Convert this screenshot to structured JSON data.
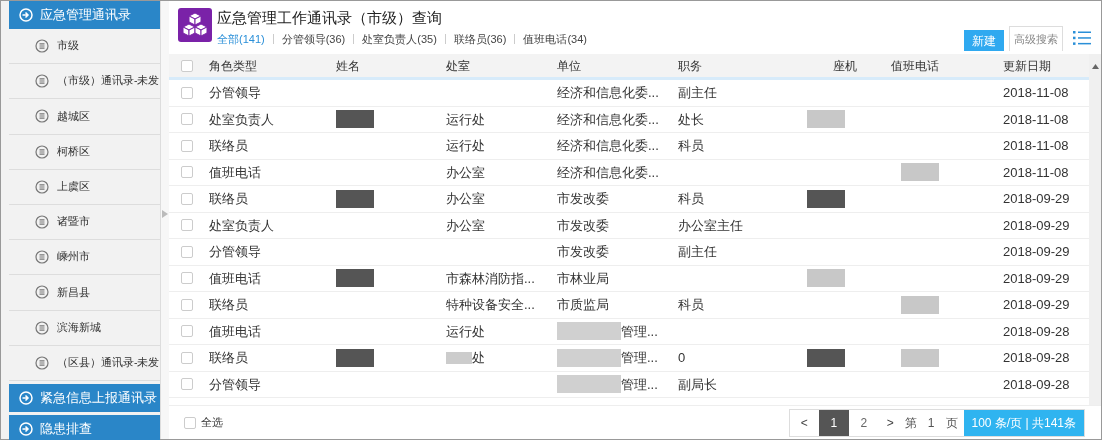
{
  "sidebar": {
    "groups": [
      {
        "label": "应急管理通讯录",
        "items": [
          {
            "label": "市级"
          },
          {
            "label": "（市级）通讯录-未发"
          },
          {
            "label": "越城区"
          },
          {
            "label": "柯桥区"
          },
          {
            "label": "上虞区"
          },
          {
            "label": "诸暨市"
          },
          {
            "label": "嵊州市"
          },
          {
            "label": "新昌县"
          },
          {
            "label": "滨海新城"
          },
          {
            "label": "（区县）通讯录-未发"
          }
        ]
      },
      {
        "label": "紧急信息上报通讯录"
      },
      {
        "label": "隐患排查"
      }
    ]
  },
  "title": "应急管理工作通讯录（市级）查询",
  "tabs": [
    {
      "label": "全部(141)",
      "selected": true
    },
    {
      "label": "分管领导(36)",
      "selected": false
    },
    {
      "label": "处室负责人(35)",
      "selected": false
    },
    {
      "label": "联络员(36)",
      "selected": false
    },
    {
      "label": "值班电话(34)",
      "selected": false
    }
  ],
  "buttons": {
    "new": "新建",
    "advanced_search": "高级搜索"
  },
  "table": {
    "header_checkbox": {
      "checked": false
    },
    "columns": [
      "角色类型",
      "姓名",
      "处室",
      "单位",
      "职务",
      "座机",
      "值班电话",
      "更新日期"
    ],
    "rows": [
      {
        "checked": false,
        "role": "分管领导",
        "name_blurred": false,
        "dept": "",
        "dept_blurred": false,
        "unit": "经济和信息化委...",
        "unit_blurred": false,
        "job": "副主任",
        "phone_blurred": false,
        "duty_blurred": false,
        "date": "2018-11-08"
      },
      {
        "checked": false,
        "role": "处室负责人",
        "name_blurred": true,
        "dept": "运行处",
        "dept_blurred": false,
        "unit": "经济和信息化委...",
        "unit_blurred": false,
        "job": "处长",
        "phone_blurred": true,
        "duty_blurred": false,
        "date": "2018-11-08"
      },
      {
        "checked": false,
        "role": "联络员",
        "name_blurred": false,
        "dept": "运行处",
        "dept_blurred": false,
        "unit": "经济和信息化委...",
        "unit_blurred": false,
        "job": "科员",
        "phone_blurred": false,
        "duty_blurred": false,
        "date": "2018-11-08"
      },
      {
        "checked": false,
        "role": "值班电话",
        "name_blurred": false,
        "dept": "办公室",
        "dept_blurred": false,
        "unit": "经济和信息化委...",
        "unit_blurred": false,
        "job": "",
        "phone_blurred": false,
        "duty_blurred": true,
        "date": "2018-11-08"
      },
      {
        "checked": false,
        "role": "联络员",
        "name_blurred": true,
        "dept": "办公室",
        "dept_blurred": false,
        "unit": "市发改委",
        "unit_blurred": false,
        "job": "科员",
        "phone_blurred": true,
        "duty_blurred": false,
        "date": "2018-09-29"
      },
      {
        "checked": false,
        "role": "处室负责人",
        "name_blurred": false,
        "dept": "办公室",
        "dept_blurred": false,
        "unit": "市发改委",
        "unit_blurred": false,
        "job": "办公室主任",
        "phone_blurred": false,
        "duty_blurred": false,
        "date": "2018-09-29"
      },
      {
        "checked": false,
        "role": "分管领导",
        "name_blurred": false,
        "dept": "",
        "dept_blurred": false,
        "unit": "市发改委",
        "unit_blurred": false,
        "job": "副主任",
        "phone_blurred": false,
        "duty_blurred": false,
        "date": "2018-09-29"
      },
      {
        "checked": false,
        "role": "值班电话",
        "name_blurred": true,
        "dept": "市森林消防指...",
        "dept_blurred": false,
        "unit": "市林业局",
        "unit_blurred": false,
        "job": "",
        "phone_blurred": true,
        "duty_blurred": false,
        "date": "2018-09-29"
      },
      {
        "checked": false,
        "role": "联络员",
        "name_blurred": false,
        "dept": "特种设备安全...",
        "dept_blurred": false,
        "unit": "市质监局",
        "unit_blurred": false,
        "job": "科员",
        "phone_blurred": false,
        "duty_blurred": true,
        "date": "2018-09-29"
      },
      {
        "checked": false,
        "role": "值班电话",
        "name_blurred": false,
        "dept": "运行处",
        "dept_blurred": false,
        "unit": "管理...",
        "unit_blurred": true,
        "job": "",
        "phone_blurred": false,
        "duty_blurred": false,
        "date": "2018-09-28"
      },
      {
        "checked": false,
        "role": "联络员",
        "name_blurred": true,
        "dept": "处",
        "dept_blurred": true,
        "unit": "管理...",
        "unit_blurred": true,
        "job": "0",
        "phone_blurred": true,
        "duty_blurred": true,
        "date": "2018-09-28"
      },
      {
        "checked": false,
        "role": "分管领导",
        "name_blurred": false,
        "dept": "",
        "dept_blurred": false,
        "unit": "管理...",
        "unit_blurred": true,
        "job": "副局长",
        "phone_blurred": false,
        "duty_blurred": false,
        "date": "2018-09-28"
      }
    ]
  },
  "footer": {
    "select_all": {
      "label": "全选",
      "checked": false
    }
  },
  "pagination": {
    "prev": "<",
    "pages": [
      {
        "label": "1",
        "selected": true
      },
      {
        "label": "2",
        "selected": false
      }
    ],
    "next": ">",
    "page_prefix": "第",
    "page_number": "1",
    "page_suffix": "页",
    "summary": "100 条/页 | 共141条"
  }
}
